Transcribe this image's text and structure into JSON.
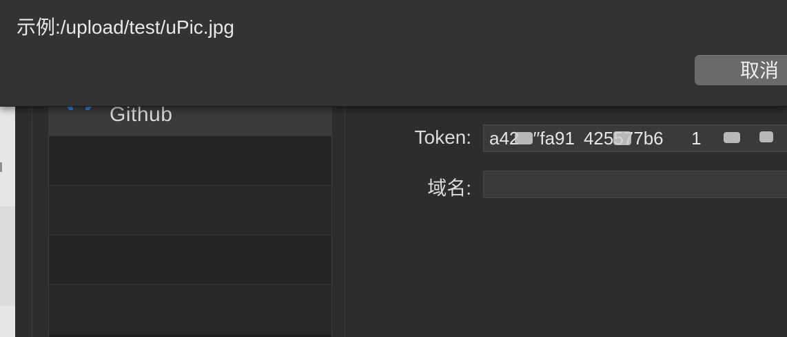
{
  "sheet": {
    "hint": "示例:/upload/test/uPic.jpg",
    "cancel_label": "取消"
  },
  "providers": {
    "items": [
      {
        "label": "Github",
        "icon": "github-icon",
        "selected": true
      },
      {
        "label": ""
      },
      {
        "label": ""
      },
      {
        "label": ""
      },
      {
        "label": ""
      }
    ]
  },
  "form": {
    "token_label": "Token:",
    "token_value": "a42  ′′fa91 425577b6    1",
    "domain_label": "域名:",
    "domain_value": ""
  },
  "colors": {
    "accent": "#2f7fd8",
    "window_bg": "#2d2d2e",
    "list_bg": "#1f1f21"
  }
}
